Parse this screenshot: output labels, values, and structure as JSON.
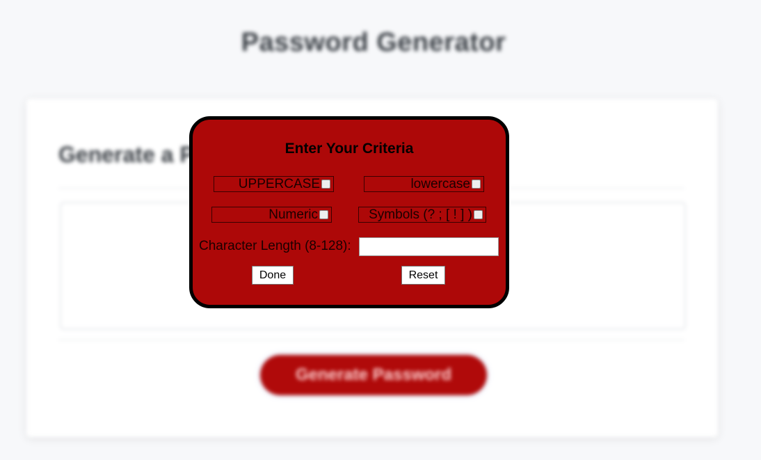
{
  "background": {
    "title": "Password Generator",
    "card_heading": "Generate a Password",
    "generate_button_label": "Generate Password"
  },
  "modal": {
    "title": "Enter Your Criteria",
    "options": {
      "uppercase": "UPPERCASE",
      "lowercase": "lowercase",
      "numeric": "Numeric",
      "symbols": "Symbols (? ; [ ! ] )"
    },
    "length_label": "Character Length (8-128):",
    "length_value": "",
    "done_label": "Done",
    "reset_label": "Reset"
  },
  "colors": {
    "modal_bg": "#ad0808",
    "button_bg": "#b00a0a",
    "page_bg": "#f7f8fa"
  }
}
